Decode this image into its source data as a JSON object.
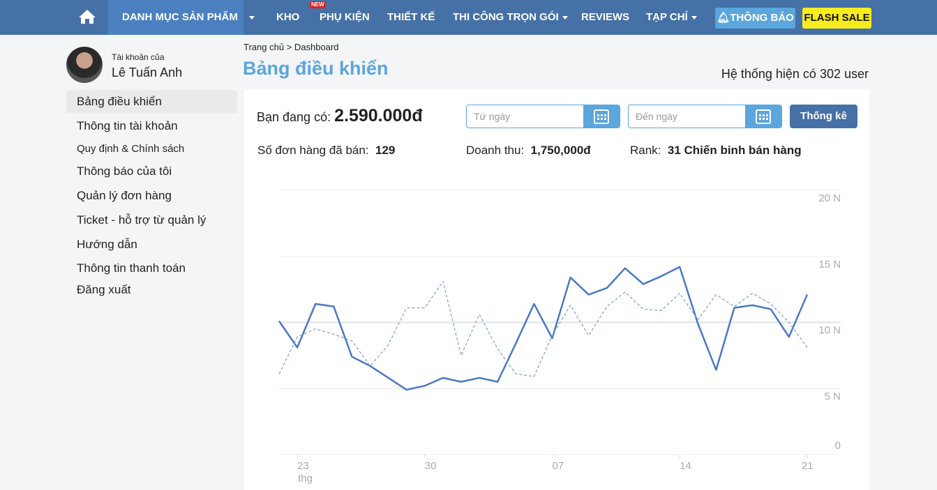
{
  "nav": {
    "items": [
      {
        "label": "DANH MỤC SẢN PHẨM"
      },
      {
        "label": "KHO"
      },
      {
        "label": "PHỤ KIỆN",
        "badge": "NEW"
      },
      {
        "label": "THIẾT KẾ"
      },
      {
        "label": "THI CÔNG TRỌN GÓI"
      },
      {
        "label": "REVIEWS"
      },
      {
        "label": "TẠP CHÍ"
      }
    ],
    "notify": "THÔNG BÁO",
    "flash": "FLASH SALE"
  },
  "user": {
    "caption": "Tài khoản của",
    "name": "Lê Tuấn Anh"
  },
  "sidebar": {
    "items": [
      {
        "label": "Bảng điều khiển"
      },
      {
        "label": "Thông tin tài khoản"
      },
      {
        "label": "Quy định & Chính sách"
      },
      {
        "label": "Thông báo của tôi"
      },
      {
        "label": "Quản lý đơn hàng"
      },
      {
        "label": "Ticket - hỗ trợ từ quản lý"
      },
      {
        "label": "Hướng dẫn"
      },
      {
        "label": "Thông tin thanh toán"
      },
      {
        "label": "Đăng xuất"
      }
    ]
  },
  "breadcrumb": {
    "home": "Trang chủ",
    "sep": ">",
    "current": "Dashboard"
  },
  "page": {
    "title": "Bảng điều khiển",
    "users": "Hệ thống hiện có 302 user"
  },
  "stats": {
    "balance_label": "Bạn đang có:",
    "balance": "2.590.000đ",
    "orders_label": "Số đơn hàng đã bán:",
    "orders": "129",
    "revenue_label": "Doanh thu:",
    "revenue": "1,750,000đ",
    "rank_label": "Rank:",
    "rank": "31 Chiến binh bán hàng"
  },
  "filter": {
    "from_placeholder": "Từ ngày",
    "to_placeholder": "Đến ngày",
    "submit": "Thống kê"
  },
  "chart_data": {
    "type": "line",
    "x_ticks": [
      "23",
      "30",
      "07",
      "14",
      "21"
    ],
    "x_sublabel": "thg",
    "y_ticks": [
      "0",
      "5 N",
      "10 N",
      "15 N",
      "20 N"
    ],
    "ylim": [
      0,
      20
    ],
    "grid": true,
    "color": "#4a78c4",
    "x": [
      "22",
      "23",
      "24",
      "25",
      "26",
      "27",
      "28",
      "29",
      "30",
      "31",
      "01",
      "02",
      "03",
      "04",
      "05",
      "06",
      "07",
      "08",
      "09",
      "10",
      "11",
      "12",
      "13",
      "14",
      "15",
      "16",
      "17",
      "18",
      "19",
      "20",
      "21"
    ],
    "series": [
      {
        "style": "solid",
        "values": [
          10.1,
          8.1,
          11.4,
          11.2,
          7.4,
          6.7,
          5.8,
          4.9,
          5.2,
          5.8,
          5.5,
          5.8,
          5.5,
          8.4,
          11.4,
          8.8,
          13.4,
          12.1,
          12.6,
          14.1,
          12.9,
          13.5,
          14.2,
          9.9,
          6.4,
          11.1,
          11.3,
          11.0,
          8.9,
          12.1
        ]
      },
      {
        "style": "dashed",
        "values": [
          6.1,
          8.9,
          9.5,
          9.1,
          8.6,
          6.7,
          8.3,
          11.1,
          11.1,
          13.1,
          7.5,
          10.6,
          8.0,
          6.1,
          5.9,
          9.0,
          11.3,
          9.0,
          11.2,
          12.3,
          11.0,
          10.9,
          12.2,
          10.2,
          12.1,
          11.2,
          12.2,
          11.4,
          10.0,
          8.1
        ]
      }
    ]
  }
}
